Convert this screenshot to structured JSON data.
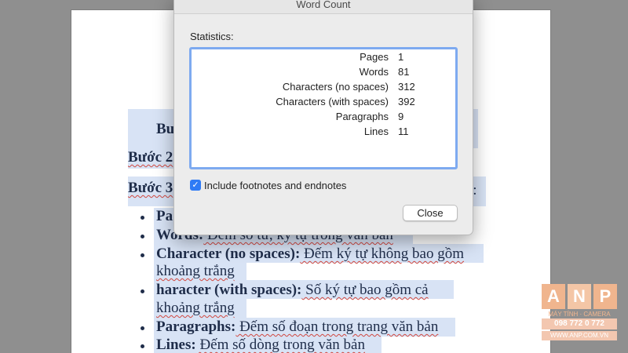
{
  "dialog": {
    "title": "Word Count",
    "statistics_label": "Statistics:",
    "stats": [
      {
        "name": "Pages",
        "value": "1"
      },
      {
        "name": "Words",
        "value": "81"
      },
      {
        "name": "Characters (no spaces)",
        "value": "312"
      },
      {
        "name": "Characters (with spaces)",
        "value": "392"
      },
      {
        "name": "Paragraphs",
        "value": "9"
      },
      {
        "name": "Lines",
        "value": "11"
      }
    ],
    "include_footnotes_label": "Include footnotes and endnotes",
    "include_footnotes_checked": true,
    "close_label": "Close"
  },
  "document": {
    "line1": "Bu",
    "line2": "Bước 2",
    "line3": "Bước 3",
    "bullet1_bold": "Pa",
    "bullet2_bold": "Words:",
    "bullet2_text": " Đếm số từ, ký tự trong văn bản",
    "bullet3_bold": "Character (no spaces):",
    "bullet3_text": " Đếm ký tự không bao gồm",
    "bullet3_cont": "khoảng trắng",
    "bullet4_bold": " haracter (with spaces):",
    "bullet4_text": " Số ký tự bao gồm cả",
    "bullet4_cont": "khoảng trắng",
    "bullet5_bold": "Paragraphs:",
    "bullet5_text": " Đếm số đoạn trong trang văn bản",
    "bullet6_bold": "Lines:",
    "bullet6_text": " Đếm số dòng trong văn bản",
    "right_fragment": "t:"
  },
  "watermark": {
    "letters": [
      "A",
      "N",
      "P"
    ],
    "line1": "MÁY TÍNH · CAMERA",
    "line2": "098 772 0 772",
    "line3": "WWW.ANP.COM.VN"
  },
  "colors": {
    "checkbox": "#2f7bf5",
    "focus_ring": "#7eaaf0",
    "highlight": "#d8e3f5",
    "logo": "#f0b58e"
  }
}
